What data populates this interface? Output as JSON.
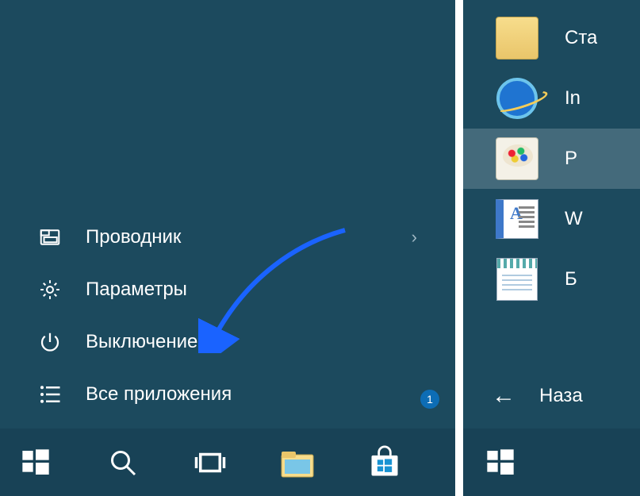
{
  "leftMenu": {
    "items": [
      {
        "label": "Проводник",
        "icon": "explorer",
        "hasChevron": true
      },
      {
        "label": "Параметры",
        "icon": "settings",
        "hasChevron": false
      },
      {
        "label": "Выключение",
        "icon": "power",
        "hasChevron": false
      },
      {
        "label": "Все приложения",
        "icon": "all-apps",
        "hasChevron": false
      }
    ],
    "badge": "1"
  },
  "rightPanel": {
    "tiles": [
      {
        "label": "Ста",
        "iconClass": "folder-icon",
        "highlighted": false
      },
      {
        "label": "In",
        "iconClass": "ie-icon",
        "highlighted": false
      },
      {
        "label": "P",
        "iconClass": "paint-icon",
        "highlighted": true
      },
      {
        "label": "W",
        "iconClass": "wordpad-icon",
        "highlighted": false
      },
      {
        "label": "Б",
        "iconClass": "notepad-icon",
        "highlighted": false
      }
    ],
    "backLabel": "Наза"
  }
}
